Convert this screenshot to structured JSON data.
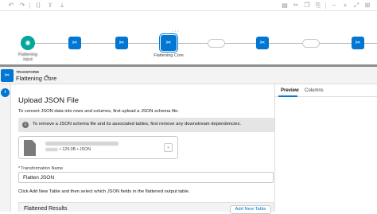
{
  "toolbar": {
    "buttons": [
      "undo-icon",
      "redo-icon",
      "code-icon",
      "upload-icon",
      "settings-icon",
      "cut-icon",
      "copy-icon",
      "paste-icon"
    ]
  },
  "canvas": {
    "start_node_label": "Flattening input",
    "selected_node_label": "Flattening Core",
    "more_glyph": "···"
  },
  "header": {
    "kicker": "TRANSFORM",
    "title": "Flattening Core",
    "pencil": "✎"
  },
  "rail": {
    "badge": "i"
  },
  "main": {
    "upload_title": "Upload JSON File",
    "instruction": "To convert JSON data into rows and columns, first upload a JSON schema file.",
    "info_text": "To remove a JSON schema file and its associated tables, first remove any downstream dependencies.",
    "file": {
      "meta": "• 129.0B • JSON"
    },
    "transformation_name_label": "Transformation Name",
    "required_mark": "*",
    "transformation_name_value": "Flatten JSON",
    "add_table_hint": "Click Add New Table and then select which JSON fields in the flattened output table.",
    "results_title": "Flattened Results",
    "add_table_button": "Add New Table"
  },
  "right_panel": {
    "tabs": [
      {
        "label": "Preview",
        "active": true
      },
      {
        "label": "Columns",
        "active": false
      }
    ]
  },
  "colors": {
    "accent": "#0176d3",
    "start_node": "#06a59a"
  }
}
